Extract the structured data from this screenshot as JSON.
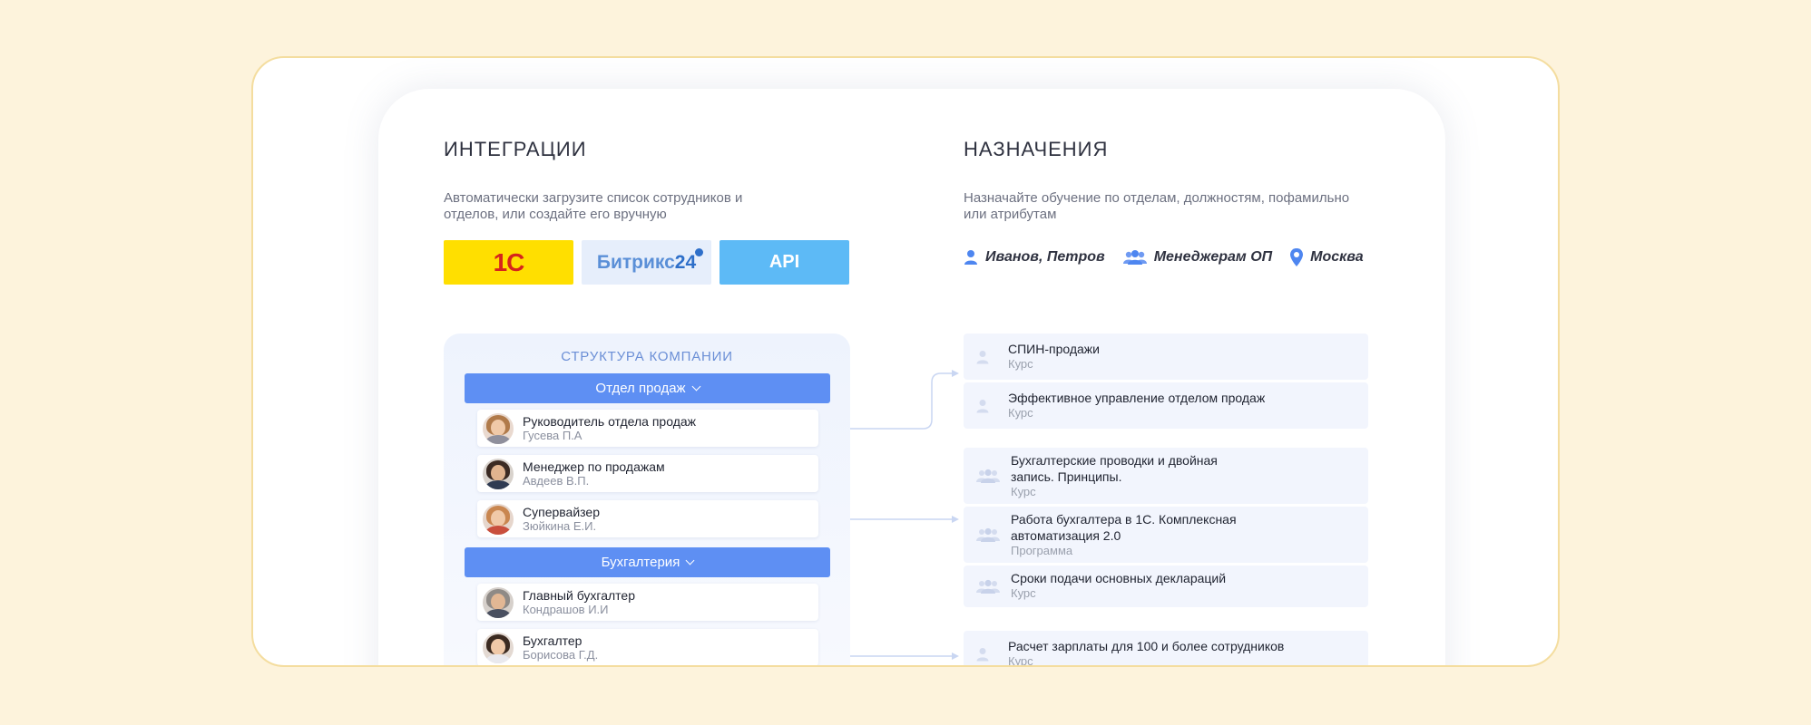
{
  "integrations": {
    "title": "ИНТЕГРАЦИИ",
    "description": "Автоматически загрузите список сотрудников и отделов, или создайте его вручную",
    "logos": [
      {
        "name": "1С",
        "label": "1С"
      },
      {
        "name": "Битрикс24",
        "label_main": "Битрикс",
        "label_num": "24"
      },
      {
        "name": "API",
        "label": "API"
      }
    ]
  },
  "assignments": {
    "title": "НАЗНАЧЕНИЯ",
    "description": "Назначайте обучение по отделам, должностям, пофамильно или атрибутам",
    "chips": [
      {
        "icon": "person-icon",
        "label": "Иванов, Петров"
      },
      {
        "icon": "group-icon",
        "label": "Менеджерам ОП"
      },
      {
        "icon": "location-pin-icon",
        "label": "Москва"
      }
    ]
  },
  "structure": {
    "title": "СТРУКТУРА КОМПАНИИ",
    "departments": [
      {
        "label": "Отдел продаж",
        "employees": [
          {
            "role": "Руководитель отдела продаж",
            "name": "Гусева П.А"
          },
          {
            "role": "Менеджер по продажам",
            "name": "Авдеев В.П."
          },
          {
            "role": "Супервайзер",
            "name": "Зюйкина Е.И."
          }
        ]
      },
      {
        "label": "Бухгалтерия",
        "employees": [
          {
            "role": "Главный бухгалтер",
            "name": "Кондрашов И.И"
          },
          {
            "role": "Бухгалтер",
            "name": "Борисова Г.Д."
          }
        ]
      }
    ]
  },
  "courses": [
    {
      "title": "СПИН-продажи",
      "type": "Курс",
      "icon": "person-icon"
    },
    {
      "title": "Эффективное управление отделом продаж",
      "type": "Курс",
      "icon": "person-icon"
    },
    {
      "title": "Бухгалтерские проводки и двойная запись. Принципы.",
      "type": "Курс",
      "icon": "group-icon"
    },
    {
      "title": "Работа бухгалтера в 1С. Комплексная автоматизация 2.0",
      "type": "Программа",
      "icon": "group-icon"
    },
    {
      "title": "Сроки подачи основных деклараций",
      "type": "Курс",
      "icon": "group-icon"
    },
    {
      "title": "Расчет зарплаты для 100 и более сотрудников",
      "type": "Курс",
      "icon": "person-icon"
    }
  ],
  "colors": {
    "background": "#fdf3dc",
    "accent": "#5e8ff3",
    "logo_1c_bg": "#ffdf00",
    "logo_api_bg": "#5dbaf6"
  }
}
